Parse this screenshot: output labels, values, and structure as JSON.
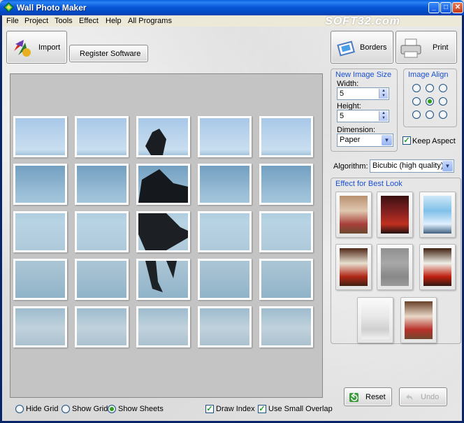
{
  "window": {
    "title": "Wall Photo Maker",
    "watermark": "SOFT32.com"
  },
  "menu": [
    "File",
    "Project",
    "Tools",
    "Effect",
    "Help",
    "All Programs"
  ],
  "toolbar": {
    "import_label": "Import",
    "register_label": "Register Software",
    "borders_label": "Borders",
    "print_label": "Print"
  },
  "image_size": {
    "heading": "New Image Size",
    "width_label": "Width:",
    "width_value": "5",
    "height_label": "Height:",
    "height_value": "5",
    "dimension_label": "Dimension:",
    "dimension_value": "Paper"
  },
  "image_align": {
    "heading": "Image Align",
    "selected": "center"
  },
  "keep_aspect": {
    "label": "Keep Aspect",
    "checked": true
  },
  "algorithm": {
    "label": "Algorithm:",
    "value": "Bicubic (high quality)"
  },
  "effects": {
    "heading": "Effect for Best Look",
    "thumbnails": [
      "effect-warm",
      "effect-dark",
      "effect-blue",
      "effect-vivid",
      "effect-emboss",
      "effect-contrast",
      "effect-sketch",
      "effect-original"
    ]
  },
  "actions": {
    "reset_label": "Reset",
    "undo_label": "Undo"
  },
  "grid_options": {
    "hide_grid": "Hide Grid",
    "show_grid": "Show Grid",
    "show_sheets": "Show Sheets",
    "selected": "show_sheets"
  },
  "draw_index": {
    "label": "Draw Index",
    "checked": true
  },
  "small_overlap": {
    "label": "Use Small Overlap",
    "checked": true
  },
  "colors": {
    "title_bar": "#0a58d8",
    "accent_label": "#1a4fd0",
    "radio_on": "#2fa21a"
  }
}
